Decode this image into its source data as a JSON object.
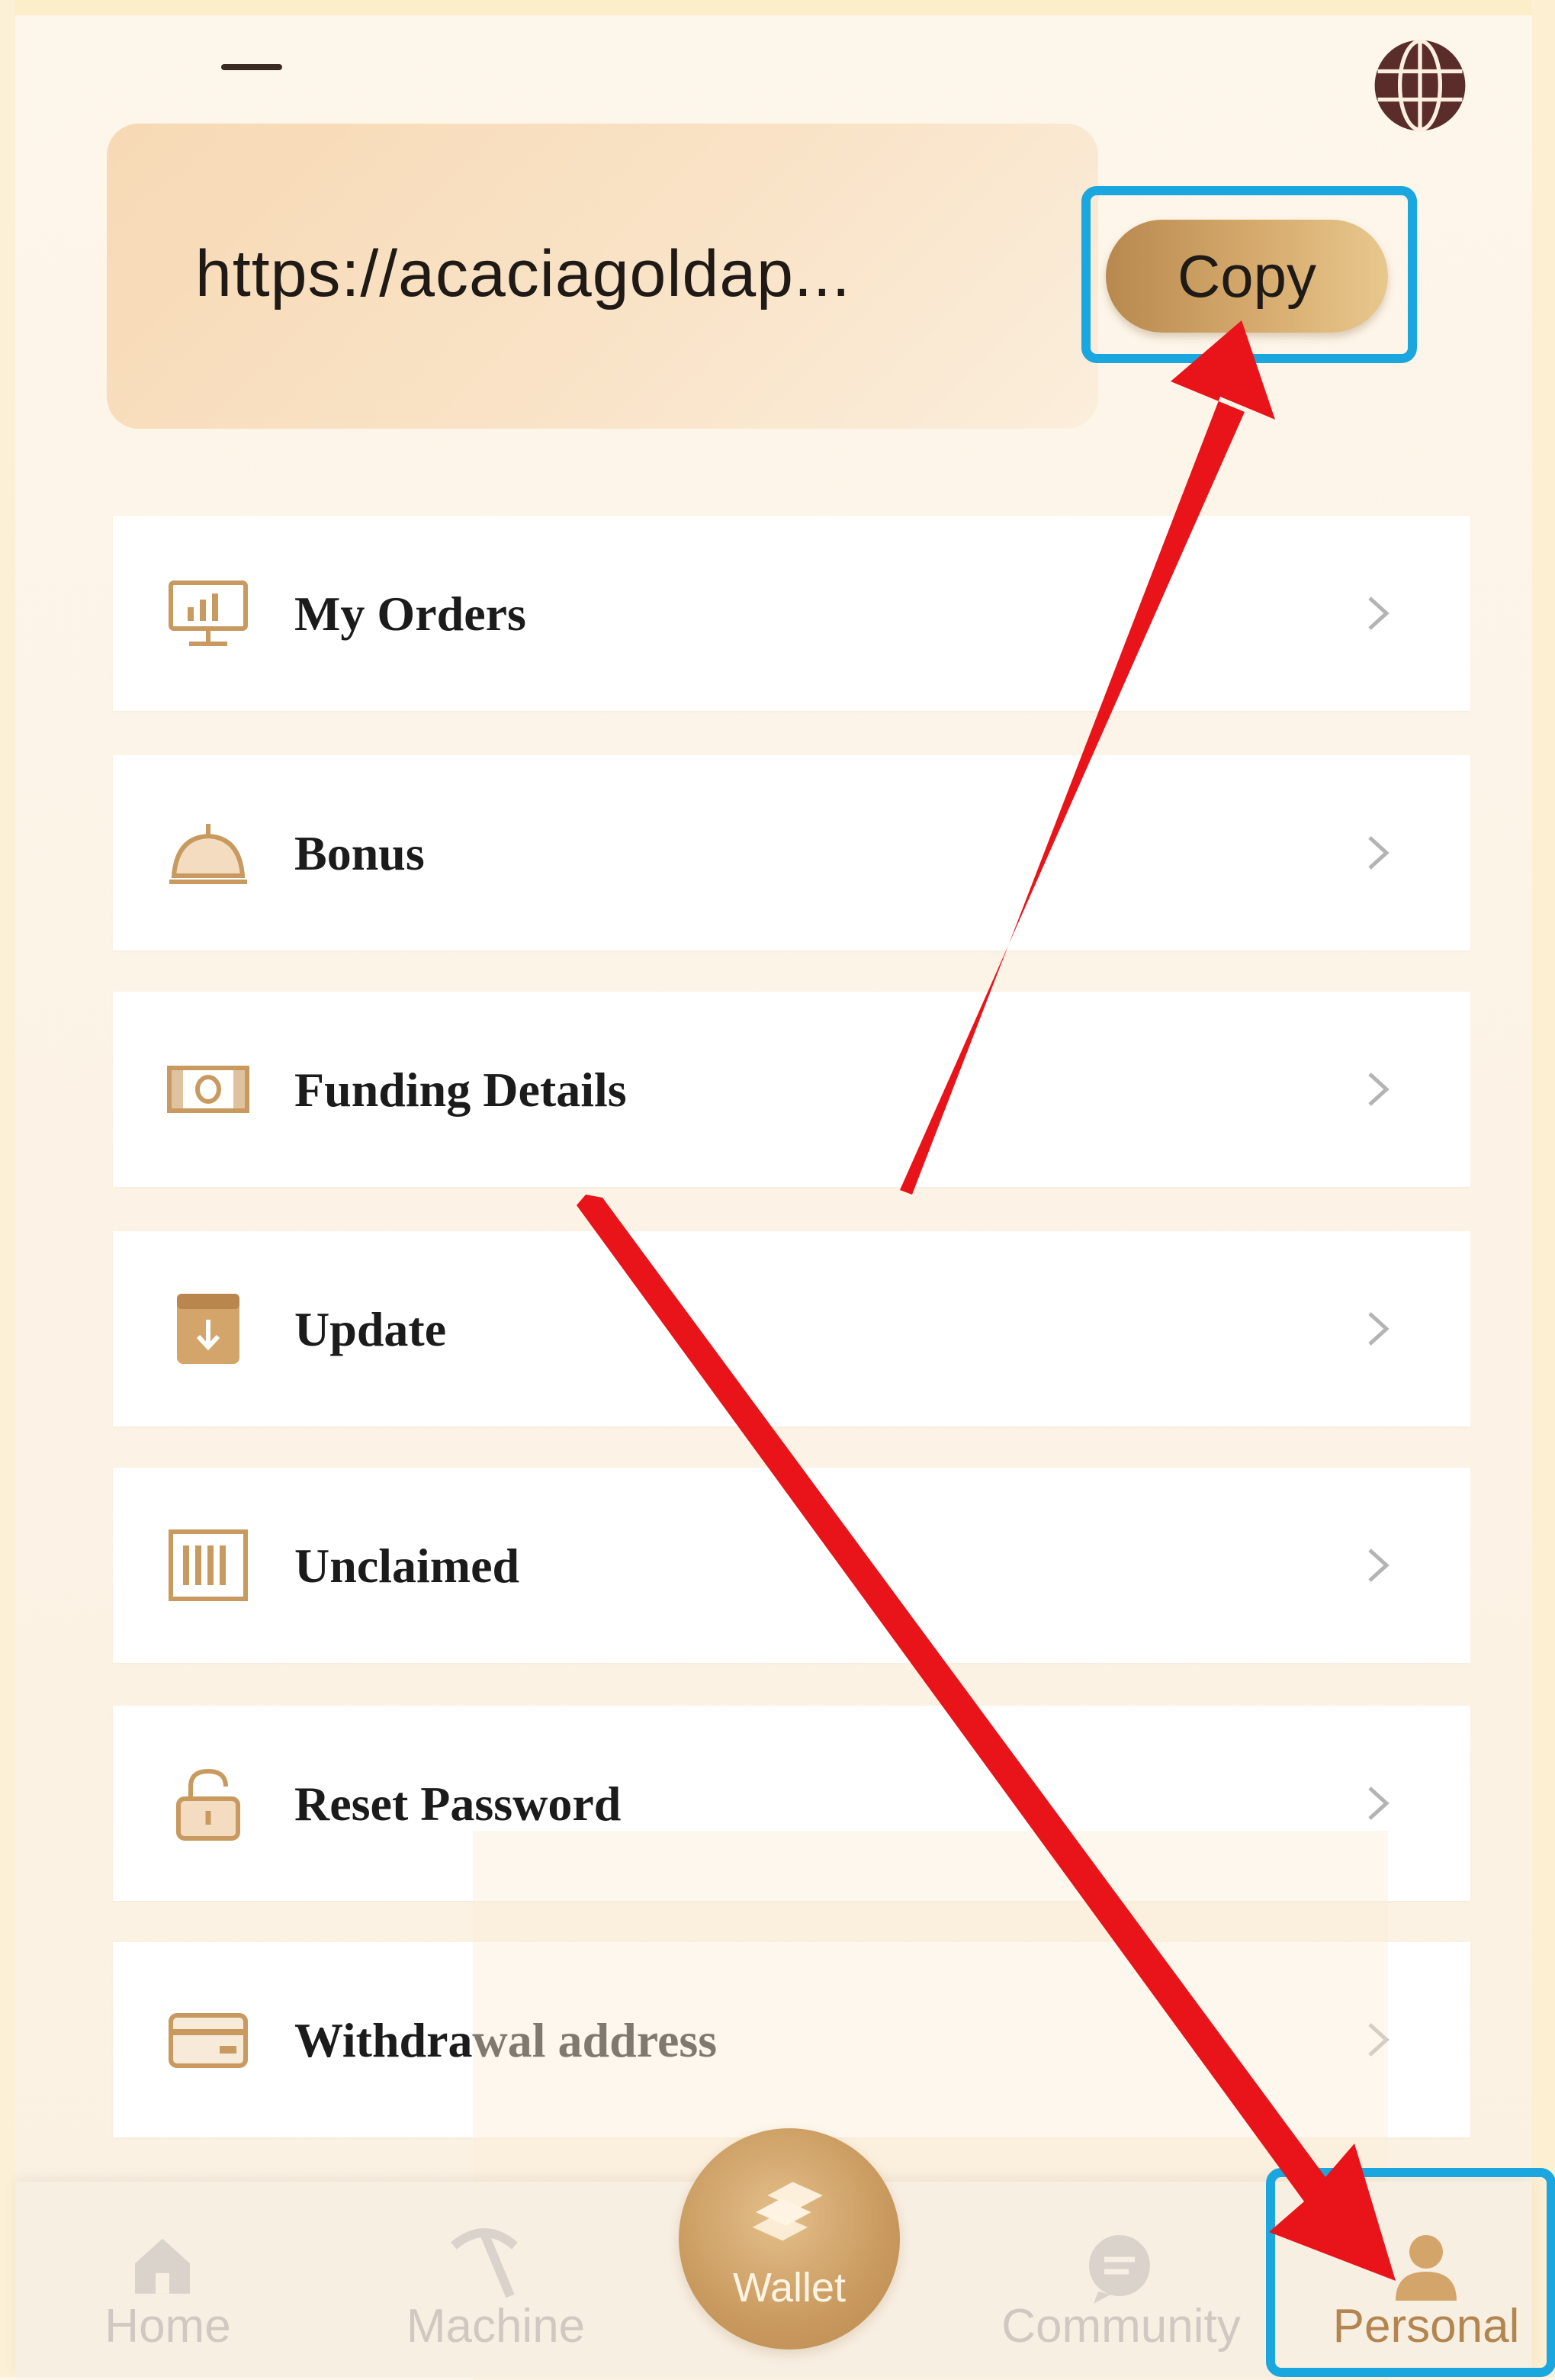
{
  "header": {
    "menu_icon": "menu-icon",
    "language_icon": "globe-icon"
  },
  "referral": {
    "url": "https://acaciagoldap...",
    "copy_label": "Copy"
  },
  "menu": {
    "items": [
      {
        "label": "My Orders",
        "icon": "chart-monitor-icon"
      },
      {
        "label": "Bonus",
        "icon": "bell-icon"
      },
      {
        "label": "Funding Details",
        "icon": "money-icon"
      },
      {
        "label": "Update",
        "icon": "download-icon"
      },
      {
        "label": "Unclaimed",
        "icon": "barcode-icon"
      },
      {
        "label": "Reset Password",
        "icon": "lock-icon"
      },
      {
        "label": "Withdrawal address",
        "icon": "card-icon"
      }
    ]
  },
  "nav": {
    "home": "Home",
    "machine": "Machine",
    "wallet": "Wallet",
    "community": "Community",
    "personal": "Personal"
  },
  "colors": {
    "accent": "#c99a5f",
    "highlight": "#1aa7df",
    "arrow": "#e8141a"
  }
}
